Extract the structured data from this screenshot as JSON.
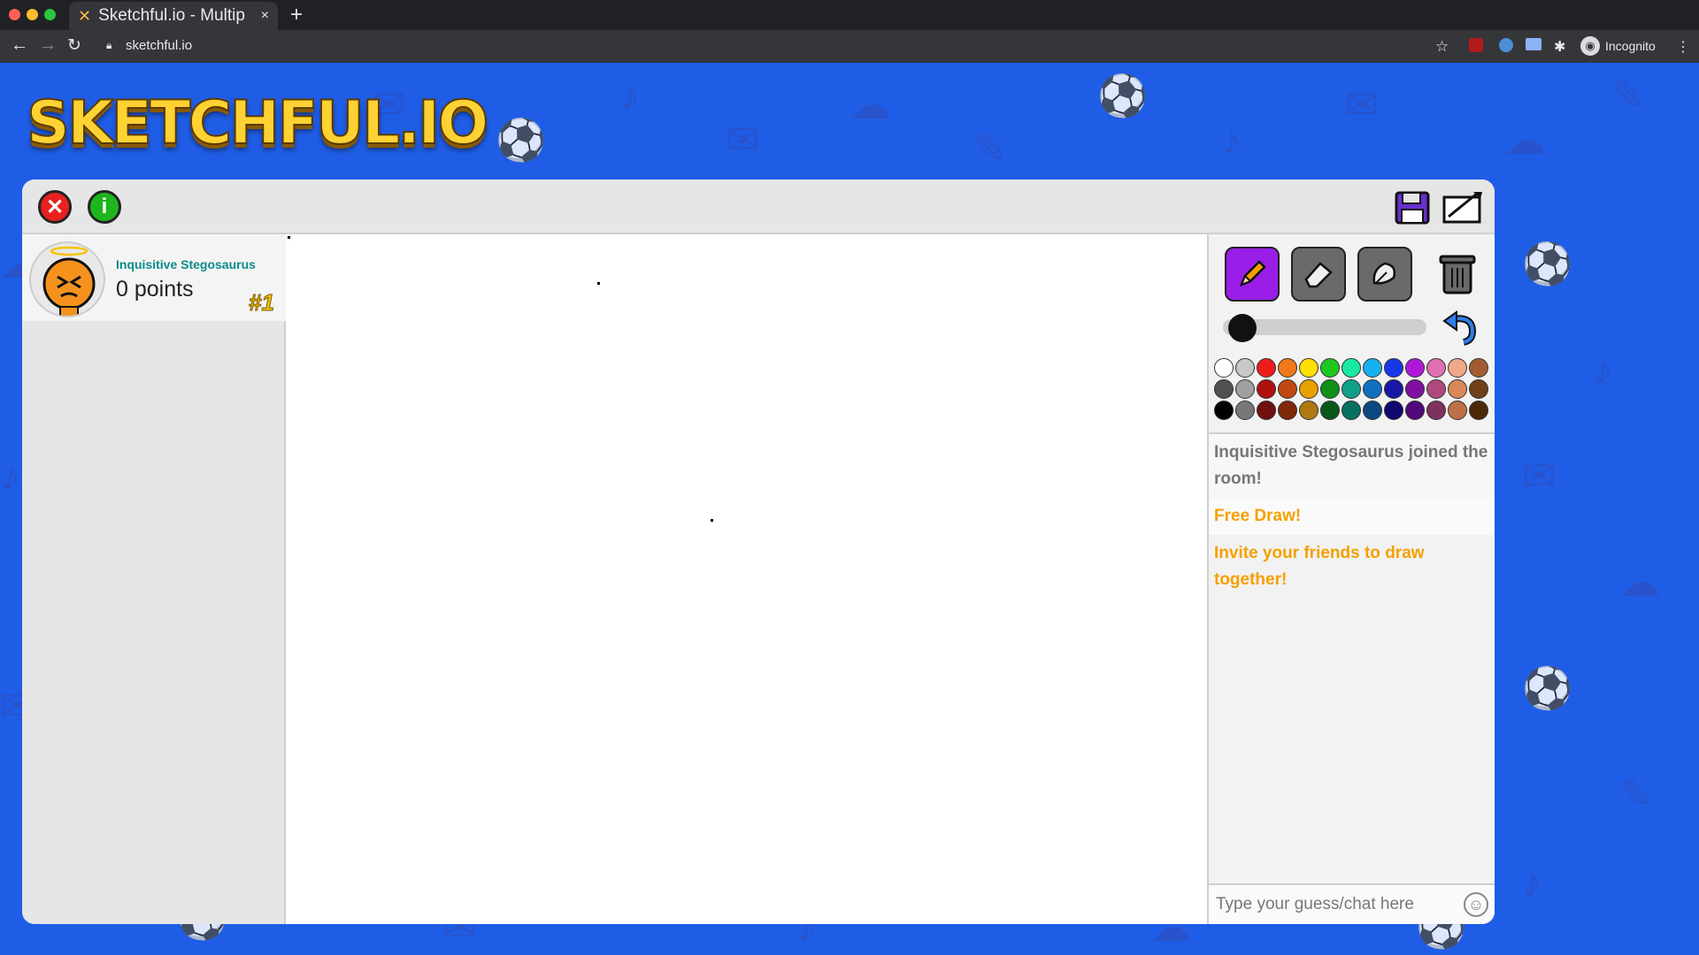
{
  "browser": {
    "tab_title": "Sketchful.io - Multip",
    "tab_favicon": "✕",
    "new_tab": "+",
    "tab_close": "×",
    "url": "sketchful.io",
    "profile_label": "Incognito"
  },
  "logo": {
    "text": "SKETCHFUL.IO"
  },
  "toolbar": {
    "exit_glyph": "✕",
    "info_glyph": "i"
  },
  "players": [
    {
      "name": "Inquisitive Stegosaurus",
      "points": "0 points",
      "rank": "#1"
    }
  ],
  "tools": {
    "brush_size_fraction": 0.05,
    "active_tool": "pencil"
  },
  "palette": {
    "rows": [
      [
        "#ffffff",
        "#c8c8c8",
        "#ee1c1c",
        "#f07818",
        "#ffe000",
        "#1fc81f",
        "#18e8a0",
        "#18b0f0",
        "#1838e8",
        "#b018d8",
        "#e070b0",
        "#f0a888",
        "#a05c30"
      ],
      [
        "#505050",
        "#a0a0a0",
        "#b01010",
        "#c04810",
        "#e8a000",
        "#109018",
        "#10a088",
        "#1070c0",
        "#1818a8",
        "#8010a0",
        "#b04880",
        "#d88858",
        "#704018"
      ],
      [
        "#000000",
        "#787878",
        "#701010",
        "#802808",
        "#b07810",
        "#085818",
        "#087060",
        "#0a4880",
        "#100870",
        "#50087a",
        "#803060",
        "#c07048",
        "#4a2808"
      ]
    ]
  },
  "chat": {
    "messages": [
      {
        "text": "Inquisitive Stegosaurus joined the room!",
        "kind": "join"
      },
      {
        "text": "Free Draw!",
        "kind": "sys"
      },
      {
        "text": "Invite your friends to draw together!",
        "kind": "sys"
      }
    ],
    "input_placeholder": "Type your guess/chat here",
    "emoji_glyph": "☺"
  },
  "colors": {
    "background": "#1f5de6",
    "tool_active": "#9b1de8",
    "tool_inactive": "#6a6a6a",
    "player_name": "#0b8a8a",
    "system_message": "#f5a000"
  }
}
